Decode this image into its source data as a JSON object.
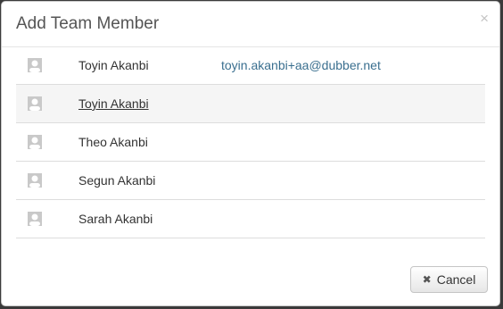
{
  "modal": {
    "title": "Add Team Member",
    "close_glyph": "×",
    "close_icon": "close-icon"
  },
  "members": [
    {
      "name": "Toyin Akanbi",
      "email": "toyin.akanbi+aa@dubber.net",
      "avatar_icon": "user-placeholder-icon"
    },
    {
      "name": "Toyin Akanbi",
      "email": "",
      "avatar_icon": "user-placeholder-icon",
      "hovered": true
    },
    {
      "name": "Theo Akanbi",
      "email": "",
      "avatar_icon": "user-placeholder-icon"
    },
    {
      "name": "Segun Akanbi",
      "email": "",
      "avatar_icon": "user-placeholder-icon"
    },
    {
      "name": "Sarah Akanbi",
      "email": "",
      "avatar_icon": "user-placeholder-icon"
    }
  ],
  "footer": {
    "cancel_label": "Cancel",
    "cancel_icon_glyph": "✖",
    "cancel_icon": "close-x-icon"
  },
  "colors": {
    "link": "#3a6f8f",
    "hover_row": "#f5f5f5",
    "avatar_bg": "#c9c9c9"
  }
}
